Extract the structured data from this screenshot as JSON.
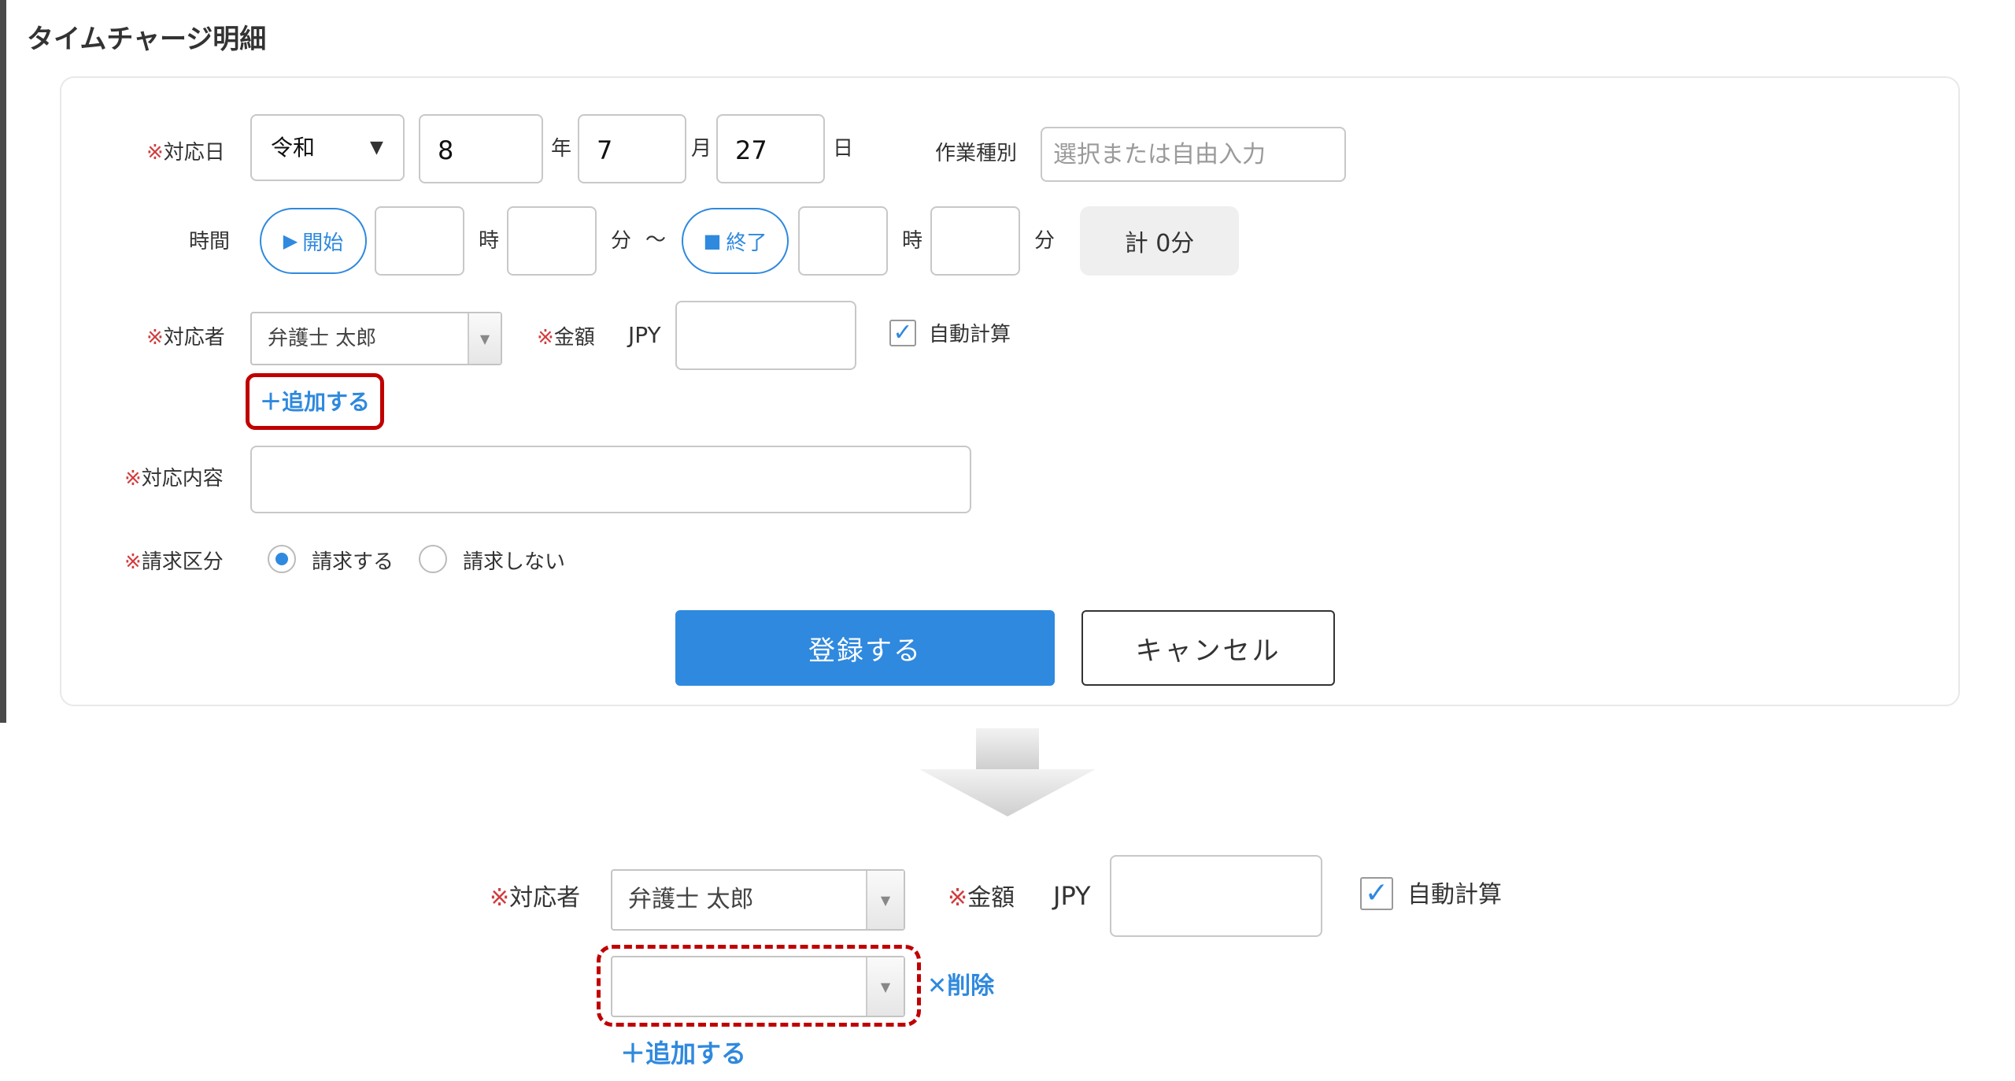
{
  "title": "タイムチャージ明細",
  "form": {
    "required_mark": "※",
    "date_label": "対応日",
    "era_value": "令和",
    "year_value": "8",
    "year_unit": "年",
    "month_value": "7",
    "month_unit": "月",
    "day_value": "27",
    "day_unit": "日",
    "work_type_label": "作業種別",
    "work_type_placeholder": "選択または自由入力",
    "time_label": "時間",
    "start_label": "開始",
    "hour_unit": "時",
    "minute_unit": "分",
    "tilde": "～",
    "end_label": "終了",
    "total": "計 0分",
    "person_label": "対応者",
    "person_value": "弁護士 太郎",
    "amount_label": "金額",
    "currency": "JPY",
    "auto_calc_label": "自動計算",
    "auto_calc_checked": true,
    "add_label": "追加する",
    "content_label": "対応内容",
    "billing_label": "請求区分",
    "billing_options": [
      "請求する",
      "請求しない"
    ],
    "billing_selected": "請求する"
  },
  "buttons": {
    "register": "登録する",
    "cancel": "キャンセル"
  },
  "after": {
    "person_label": "対応者",
    "person_value": "弁護士 太郎",
    "amount_label": "金額",
    "currency": "JPY",
    "auto_calc_label": "自動計算",
    "new_person_value": "",
    "delete_label": "削除",
    "add_label": "追加する"
  },
  "colors": {
    "accent": "#2f89de",
    "required": "#d23c3c",
    "highlight": "#c00000"
  },
  "icons": {
    "start": "play-icon",
    "end": "stop-icon",
    "add": "plus-icon",
    "delete": "close-icon",
    "dropdown": "caret-down-icon",
    "flow": "down-arrow-icon"
  }
}
